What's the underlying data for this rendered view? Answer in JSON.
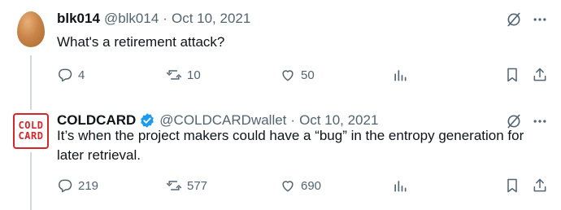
{
  "tweets": [
    {
      "author_name": "blk014",
      "handle": "@blk014",
      "separator": "·",
      "date": "Oct 10, 2021",
      "text": "What's a retirement attack?",
      "avatar_icon": "egg-avatar",
      "verified": false,
      "replies": "4",
      "retweets": "10",
      "likes": "50"
    },
    {
      "author_name": "COLDCARD",
      "handle": "@COLDCARDwallet",
      "separator": "·",
      "date": "Oct 10, 2021",
      "text": "It’s when the project makers could have a “bug” in the entropy generation for later retrieval.",
      "avatar_icon": "coldcard-logo",
      "avatar_text_line1": "COLD",
      "avatar_text_line2": "CARD",
      "verified": true,
      "replies": "219",
      "retweets": "577",
      "likes": "690"
    }
  ],
  "colors": {
    "text": "#0f1419",
    "secondary": "#536471",
    "verified_blue": "#1d9bf0",
    "thread_line": "#cfd9de",
    "coldcard_red": "#d7262b"
  }
}
